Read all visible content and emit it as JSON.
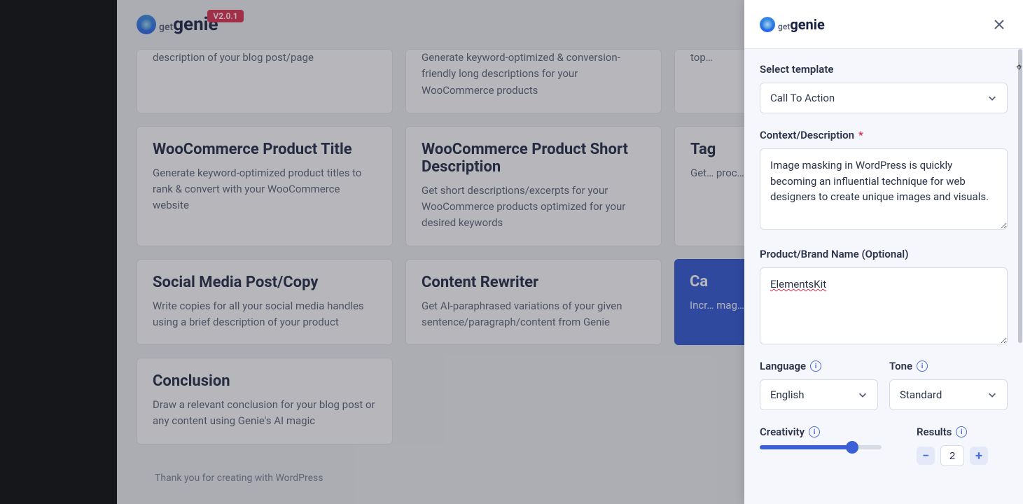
{
  "header": {
    "logo_get": "get",
    "logo_name": "genie",
    "version": "V2.0.1"
  },
  "partial_row": {
    "card1_desc": "description of your blog post/page",
    "card2_desc": "Generate keyword-optimized & conversion-friendly long descriptions for your WooCommerce products",
    "card3_desc": "top…"
  },
  "cards": [
    [
      {
        "title": "WooCommerce Product Title",
        "desc": "Generate keyword-optimized product titles to rank & convert with your WooCommerce website"
      },
      {
        "title": "WooCommerce Product Short Description",
        "desc": "Get short descriptions/excerpts for your WooCommerce products optimized for your desired keywords"
      },
      {
        "title": "Tag",
        "desc": "Get…\nproc…",
        "cut": true
      }
    ],
    [
      {
        "title": "Social Media Post/Copy",
        "desc": "Write copies for all your social media handles using a brief description of your product"
      },
      {
        "title": "Content Rewriter",
        "desc": "Get AI-paraphrased variations of your given sentence/paragraph/content from Genie"
      },
      {
        "title": "Ca",
        "desc": "Incr…\nmag…",
        "cta": true
      }
    ],
    [
      {
        "title": "Conclusion",
        "desc": "Draw a relevant conclusion for your blog post or any content using Genie's AI magic"
      }
    ]
  ],
  "footer": "Thank you for creating with WordPress",
  "panel": {
    "logo_get": "get",
    "logo_name": "genie",
    "template_label": "Select template",
    "template_value": "Call To Action",
    "context_label": "Context/Description",
    "context_value": "Image masking in WordPress is quickly becoming an influential technique for web designers to create unique images and visuals.",
    "brand_label": "Product/Brand Name (Optional)",
    "brand_value": "ElementsKit",
    "language_label": "Language",
    "language_value": "English",
    "tone_label": "Tone",
    "tone_value": "Standard",
    "creativity_label": "Creativity",
    "results_label": "Results",
    "results_value": "2"
  }
}
